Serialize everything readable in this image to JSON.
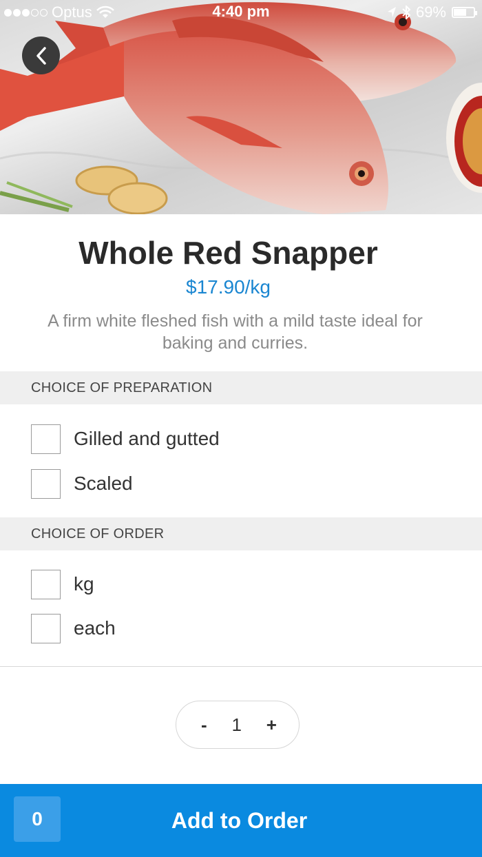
{
  "status_bar": {
    "carrier": "Optus",
    "time": "4:40 pm",
    "battery": "69%",
    "signal_icon": "signal-dots-icon",
    "wifi_icon": "wifi-icon",
    "bluetooth_icon": "bluetooth-icon",
    "location_icon": "location-arrow-icon",
    "battery_icon": "battery-icon"
  },
  "hero": {
    "back_icon": "chevron-left-icon",
    "image_subject": "red-snapper-photo"
  },
  "product": {
    "title": "Whole Red Snapper",
    "price": "$17.90/kg",
    "description": "A firm white fleshed fish with a mild taste ideal for baking and curries."
  },
  "sections": {
    "preparation": {
      "header": "CHOICE OF PREPARATION",
      "options": [
        {
          "label": "Gilled and gutted",
          "checked": false
        },
        {
          "label": "Scaled",
          "checked": false
        }
      ]
    },
    "order": {
      "header": "CHOICE OF ORDER",
      "options": [
        {
          "label": "kg",
          "checked": false
        },
        {
          "label": "each",
          "checked": false
        }
      ]
    }
  },
  "quantity": {
    "decrement": "-",
    "value": "1",
    "increment": "+"
  },
  "footer": {
    "cart_count": "0",
    "add_label": "Add to Order"
  },
  "colors": {
    "accent": "#0a8ae0",
    "price": "#1a86d1",
    "section_bg": "#efefef"
  }
}
